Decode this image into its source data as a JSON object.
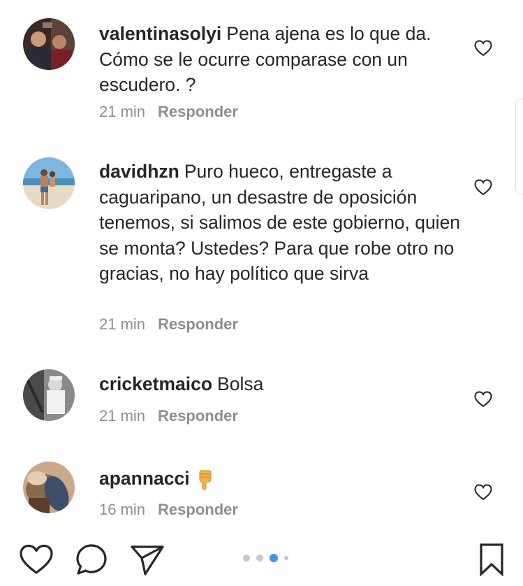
{
  "comments": [
    {
      "username": "valentinasolyi",
      "text": "Pena ajena es lo que da. Cómo se le ocurre comparase con un escudero. ?",
      "time": "21 min",
      "reply_label": "Responder"
    },
    {
      "username": "davidhzn",
      "text": "Puro hueco, entregaste a caguaripano, un desastre de oposición tenemos, si salimos de este gobierno, quien se monta? Ustedes? Para que robe otro no gracias, no hay político que sirva",
      "time": "21 min",
      "reply_label": "Responder"
    },
    {
      "username": "cricketmaico",
      "text": "Bolsa",
      "time": "21 min",
      "reply_label": "Responder"
    },
    {
      "username": "apannacci",
      "text": "",
      "emoji": "thumbs-down-emoji",
      "time": "16 min",
      "reply_label": "Responder"
    }
  ],
  "icons": {
    "like": "heart-outline-icon",
    "comment": "comment-bubble-icon",
    "share": "paper-plane-icon",
    "save": "bookmark-icon"
  },
  "carousel": {
    "count": 5,
    "active_index": 2
  },
  "colors": {
    "text": "#262626",
    "meta": "#8e8e8e",
    "active_dot": "#3897f0",
    "dot": "#c7c7c7"
  }
}
